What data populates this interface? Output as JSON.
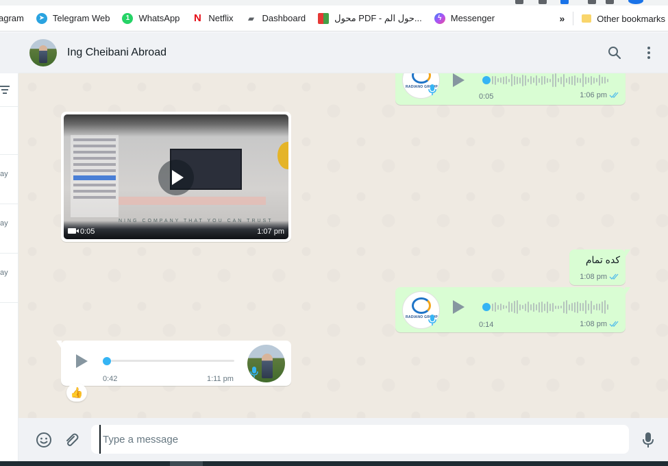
{
  "bookmarks": {
    "items": [
      {
        "label": "agram",
        "icon": "instagram-icon"
      },
      {
        "label": "Telegram Web",
        "icon": "telegram-icon",
        "color": "#2aa3e0"
      },
      {
        "label": "WhatsApp",
        "icon": "whatsapp-icon",
        "color": "#25d366"
      },
      {
        "label": "Netflix",
        "icon": "netflix-icon",
        "color": "#e50914"
      },
      {
        "label": "Dashboard",
        "icon": "dashboard-icon"
      },
      {
        "label": "محول PDF - حول الم...",
        "icon": "pdf-converter-icon"
      },
      {
        "label": "Messenger",
        "icon": "messenger-icon",
        "color": "#8a5cf6"
      }
    ],
    "overflow": "»",
    "other": "Other bookmarks"
  },
  "chatlist": {
    "snippets": [
      "ay",
      "ay",
      "ay"
    ]
  },
  "header": {
    "contact_name": "Ing Cheibani Abroad",
    "search_icon": "search-icon",
    "menu_icon": "menu-icon"
  },
  "messages": {
    "voice1": {
      "duration": "0:05",
      "time": "1:06 pm",
      "brand": "RADIANO GROUP"
    },
    "video": {
      "duration": "0:05",
      "time": "1:07 pm",
      "watermark": "NING COMPANY THAT YOU CAN TRUST"
    },
    "text1": {
      "text": "كده تمام",
      "time": "1:08 pm"
    },
    "voice2": {
      "duration": "0:14",
      "time": "1:08 pm",
      "brand": "RADIANO GROUP"
    },
    "voice3": {
      "duration": "0:42",
      "time": "1:11 pm",
      "reaction": "👍"
    }
  },
  "composer": {
    "placeholder": "Type a message",
    "value": ""
  },
  "colors": {
    "outgoing": "#d9fdd3",
    "incoming": "#ffffff",
    "accent": "#35b4f4",
    "read_ticks": "#53bdeb"
  }
}
